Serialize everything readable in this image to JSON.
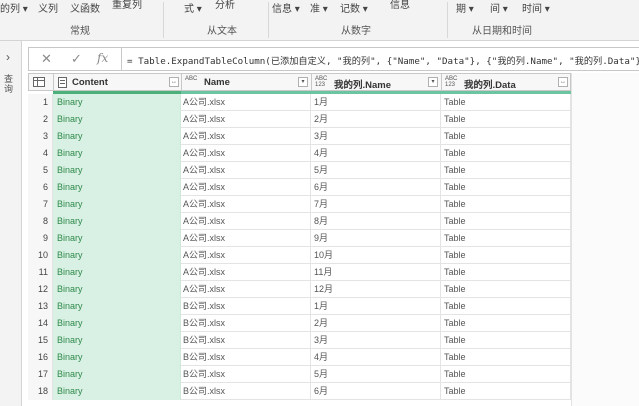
{
  "ribbon": {
    "top_items": [
      "的列 ▾",
      "义列",
      "义函数",
      "重复列",
      "式 ▾",
      "分析",
      "信息 ▾",
      "准 ▾",
      "记数 ▾",
      "信息",
      "期 ▾",
      "间 ▾",
      "时间 ▾"
    ],
    "groups": [
      "常规",
      "从文本",
      "从数字",
      "从日期和时间"
    ]
  },
  "left_pane": {
    "label": "查询"
  },
  "formula_bar": {
    "cancel_icon": "close-icon",
    "confirm_icon": "check-icon",
    "fx_label": "fx",
    "formula": "= Table.ExpandTableColumn(已添加自定义, \"我的列\", {\"Name\", \"Data\"}, {\"我的列.Name\", \"我的列.Data\"})"
  },
  "grid": {
    "columns": [
      {
        "type": "",
        "label": "Content"
      },
      {
        "type": "ABC",
        "label": "Name"
      },
      {
        "type": "ABC\n123",
        "label": "我的列.Name"
      },
      {
        "type": "ABC\n123",
        "label": "我的列.Data"
      }
    ],
    "rows": [
      {
        "n": "1",
        "content": "Binary",
        "name": "A公司.xlsx",
        "month": "1月",
        "data": "Table"
      },
      {
        "n": "2",
        "content": "Binary",
        "name": "A公司.xlsx",
        "month": "2月",
        "data": "Table"
      },
      {
        "n": "3",
        "content": "Binary",
        "name": "A公司.xlsx",
        "month": "3月",
        "data": "Table"
      },
      {
        "n": "4",
        "content": "Binary",
        "name": "A公司.xlsx",
        "month": "4月",
        "data": "Table"
      },
      {
        "n": "5",
        "content": "Binary",
        "name": "A公司.xlsx",
        "month": "5月",
        "data": "Table"
      },
      {
        "n": "6",
        "content": "Binary",
        "name": "A公司.xlsx",
        "month": "6月",
        "data": "Table"
      },
      {
        "n": "7",
        "content": "Binary",
        "name": "A公司.xlsx",
        "month": "7月",
        "data": "Table"
      },
      {
        "n": "8",
        "content": "Binary",
        "name": "A公司.xlsx",
        "month": "8月",
        "data": "Table"
      },
      {
        "n": "9",
        "content": "Binary",
        "name": "A公司.xlsx",
        "month": "9月",
        "data": "Table"
      },
      {
        "n": "10",
        "content": "Binary",
        "name": "A公司.xlsx",
        "month": "10月",
        "data": "Table"
      },
      {
        "n": "11",
        "content": "Binary",
        "name": "A公司.xlsx",
        "month": "11月",
        "data": "Table"
      },
      {
        "n": "12",
        "content": "Binary",
        "name": "A公司.xlsx",
        "month": "12月",
        "data": "Table"
      },
      {
        "n": "13",
        "content": "Binary",
        "name": "B公司.xlsx",
        "month": "1月",
        "data": "Table"
      },
      {
        "n": "14",
        "content": "Binary",
        "name": "B公司.xlsx",
        "month": "2月",
        "data": "Table"
      },
      {
        "n": "15",
        "content": "Binary",
        "name": "B公司.xlsx",
        "month": "3月",
        "data": "Table"
      },
      {
        "n": "16",
        "content": "Binary",
        "name": "B公司.xlsx",
        "month": "4月",
        "data": "Table"
      },
      {
        "n": "17",
        "content": "Binary",
        "name": "B公司.xlsx",
        "month": "5月",
        "data": "Table"
      },
      {
        "n": "18",
        "content": "Binary",
        "name": "B公司.xlsx",
        "month": "6月",
        "data": "Table"
      }
    ]
  },
  "colors": {
    "content_bg": "#d9f0e4",
    "content_text": "#2f8a4a",
    "accent": "#4cb07a"
  }
}
